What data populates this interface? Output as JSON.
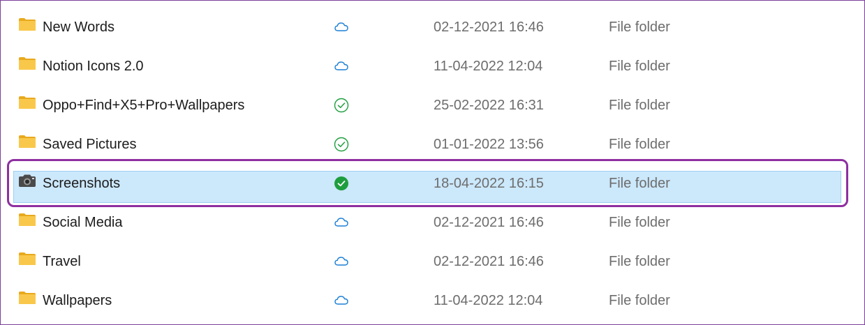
{
  "rows": [
    {
      "name": "New Words",
      "status": "cloud",
      "date": "02-12-2021 16:46",
      "type": "File folder",
      "icon": "folder-icon"
    },
    {
      "name": "Notion Icons 2.0",
      "status": "cloud",
      "date": "11-04-2022 12:04",
      "type": "File folder",
      "icon": "folder-icon"
    },
    {
      "name": "Oppo+Find+X5+Pro+Wallpapers",
      "status": "check-outline",
      "date": "25-02-2022 16:31",
      "type": "File folder",
      "icon": "folder-icon"
    },
    {
      "name": "Saved Pictures",
      "status": "check-outline",
      "date": "01-01-2022 13:56",
      "type": "File folder",
      "icon": "folder-icon"
    },
    {
      "name": "Screenshots",
      "status": "check-filled",
      "date": "18-04-2022 16:15",
      "type": "File folder",
      "icon": "camera-icon",
      "selected": true
    },
    {
      "name": "Social Media",
      "status": "cloud",
      "date": "02-12-2021 16:46",
      "type": "File folder",
      "icon": "folder-icon"
    },
    {
      "name": "Travel",
      "status": "cloud",
      "date": "02-12-2021 16:46",
      "type": "File folder",
      "icon": "folder-icon"
    },
    {
      "name": "Wallpapers",
      "status": "cloud",
      "date": "11-04-2022 12:04",
      "type": "File folder",
      "icon": "folder-icon"
    }
  ],
  "colors": {
    "selection_bg": "#cce8fb",
    "selection_border": "#9fd0f3",
    "highlight_outline": "#8e2fa0",
    "cloud_icon": "#1a7fd6",
    "check_icon": "#1e9e3e",
    "folder_yellow": "#f9c84b"
  }
}
